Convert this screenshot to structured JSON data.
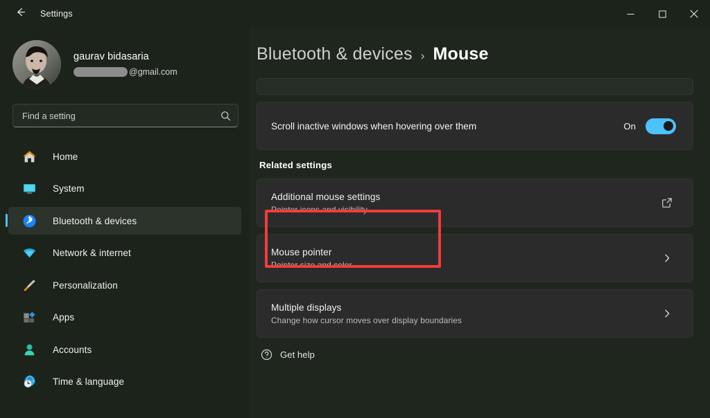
{
  "window": {
    "title": "Settings",
    "back_icon": "back-arrow-icon",
    "minimize_label": "Minimize",
    "maximize_label": "Maximize",
    "close_label": "Close"
  },
  "account": {
    "name": "gaurav bidasaria",
    "email_suffix": "@gmail.com",
    "email_redacted": true
  },
  "search": {
    "placeholder": "Find a setting",
    "icon": "search-icon"
  },
  "sidebar": {
    "items": [
      {
        "label": "Home",
        "icon": "home-icon",
        "selected": false
      },
      {
        "label": "System",
        "icon": "system-icon",
        "selected": false
      },
      {
        "label": "Bluetooth & devices",
        "icon": "bluetooth-icon",
        "selected": true
      },
      {
        "label": "Network & internet",
        "icon": "wifi-icon",
        "selected": false
      },
      {
        "label": "Personalization",
        "icon": "paintbrush-icon",
        "selected": false
      },
      {
        "label": "Apps",
        "icon": "apps-icon",
        "selected": false
      },
      {
        "label": "Accounts",
        "icon": "person-icon",
        "selected": false
      },
      {
        "label": "Time & language",
        "icon": "clock-globe-icon",
        "selected": false
      }
    ]
  },
  "breadcrumb": {
    "parent": "Bluetooth & devices",
    "separator": "›",
    "current": "Mouse"
  },
  "main": {
    "scroll_inactive": {
      "label": "Scroll inactive windows when hovering over them",
      "state": "On",
      "enabled": true
    },
    "related_settings_heading": "Related settings",
    "cards": [
      {
        "title": "Additional mouse settings",
        "subtitle": "Pointer icons and visibility",
        "action_icon": "external-link-icon",
        "highlighted": true
      },
      {
        "title": "Mouse pointer",
        "subtitle": "Pointer size and color",
        "action_icon": "chevron-right-icon",
        "highlighted": false
      },
      {
        "title": "Multiple displays",
        "subtitle": "Change how cursor moves over display boundaries",
        "action_icon": "chevron-right-icon",
        "highlighted": false
      }
    ],
    "get_help": {
      "label": "Get help",
      "icon": "help-icon"
    }
  },
  "colors": {
    "accent": "#4cc2ff",
    "highlight": "#f43b3b",
    "page_bg": "#1e261e",
    "sidebar_bg": "#1b231b",
    "card_bg": "#2b2b2b"
  }
}
